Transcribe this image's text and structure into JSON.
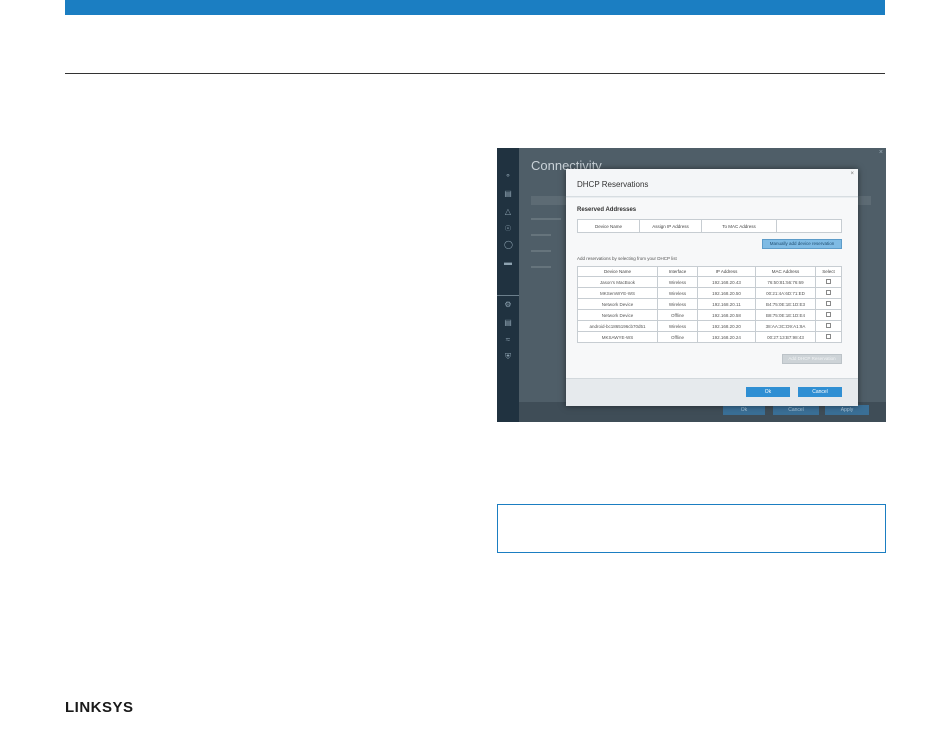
{
  "brand": {
    "logo": "LINKSYS",
    "accent_color": "#1b7ec2"
  },
  "screenshot": {
    "background_title": "Connectivity",
    "background_buttons": [
      "Ok",
      "Cancel",
      "Apply"
    ],
    "sidebar_icons": [
      "update-icon",
      "devices-icon",
      "warning-icon",
      "parental-icon",
      "priority-icon",
      "media-icon",
      "connectivity-icon",
      "troubleshoot-icon",
      "wireless-icon",
      "security-icon"
    ],
    "dialog": {
      "title": "DHCP Reservations",
      "close_label": "×",
      "reserved_section_title": "Reserved Addresses",
      "reserved_headers": [
        "Device Name",
        "Assign IP Address",
        "To MAC Address",
        ""
      ],
      "manual_button": "Manually add device reservation",
      "hint": "Add reservations by selecting from your DHCP list",
      "dhcp_headers": [
        "Device Name",
        "Interface",
        "IP Address",
        "MAC Address",
        "Select"
      ],
      "dhcp_rows": [
        {
          "name": "Jason's MacBook",
          "interface": "Wireless",
          "ip": "192.168.20.43",
          "mac": "76:50:81:56:76:69"
        },
        {
          "name": "MKSemWYE-WS",
          "interface": "Wireless",
          "ip": "192.168.20.50",
          "mac": "00:21:4A:6D:71:ED"
        },
        {
          "name": "Network Device",
          "interface": "Wireless",
          "ip": "192.168.20.11",
          "mac": "B4:75:0E:1E:1D:E3"
        },
        {
          "name": "Network Device",
          "interface": "Offline",
          "ip": "192.168.20.58",
          "mac": "B8:75:0E:1E:1D:E4"
        },
        {
          "name": "android-bc1865196cb70d51",
          "interface": "Wireless",
          "ip": "192.168.20.20",
          "mac": "38:AA:3C:D9:A1:9A"
        },
        {
          "name": "MKSAWYE-WS",
          "interface": "Offline",
          "ip": "192.168.20.24",
          "mac": "00:27:13:B7:98:43"
        }
      ],
      "add_button": "Add DHCP Reservation",
      "ok_button": "Ok",
      "cancel_button": "Cancel"
    }
  }
}
